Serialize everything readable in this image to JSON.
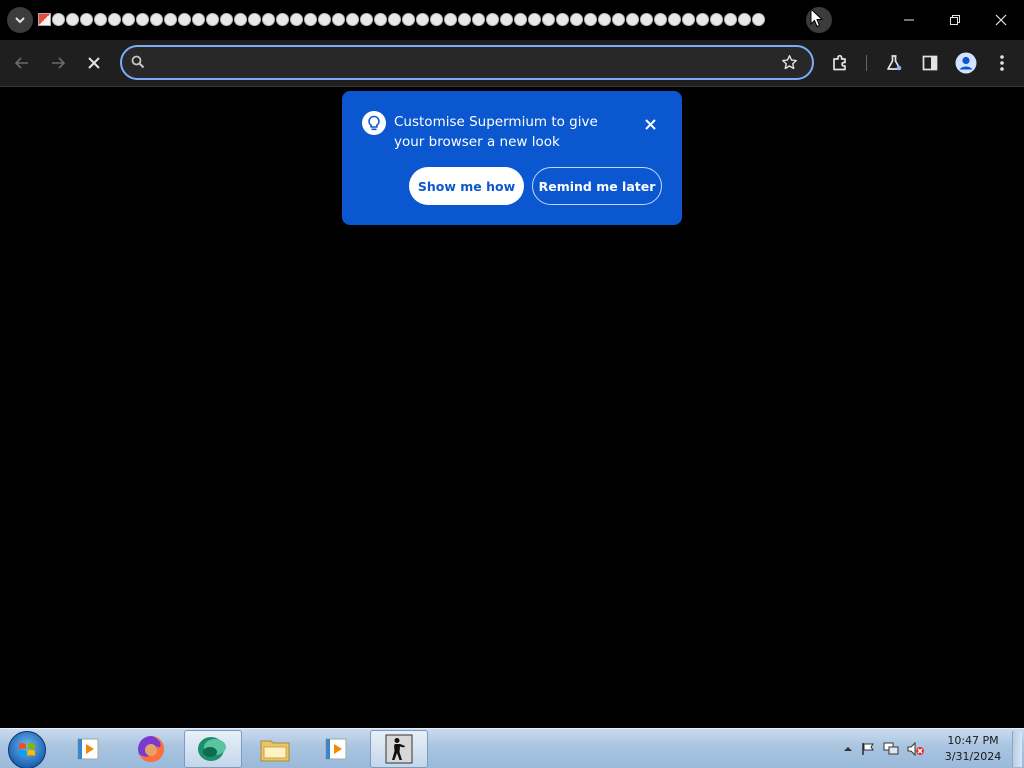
{
  "browser": {
    "app_name": "Supermium",
    "omnibox": {
      "value": "",
      "placeholder": ""
    },
    "tab_count": 52
  },
  "promo": {
    "message": "Customise Supermium to give your browser a new look",
    "primary_label": "Show me how",
    "secondary_label": "Remind me later",
    "accent_color": "#0b57d0"
  },
  "taskbar": {
    "clock_time": "10:47 PM",
    "clock_date": "3/31/2024",
    "apps": [
      "media-player",
      "firefox",
      "browser-active",
      "file-explorer",
      "media-player",
      "counter-strike"
    ]
  },
  "colors": {
    "toolbar_bg": "#1f1f1f",
    "omnibox_border": "#7cacf8",
    "page_bg": "#000000"
  }
}
